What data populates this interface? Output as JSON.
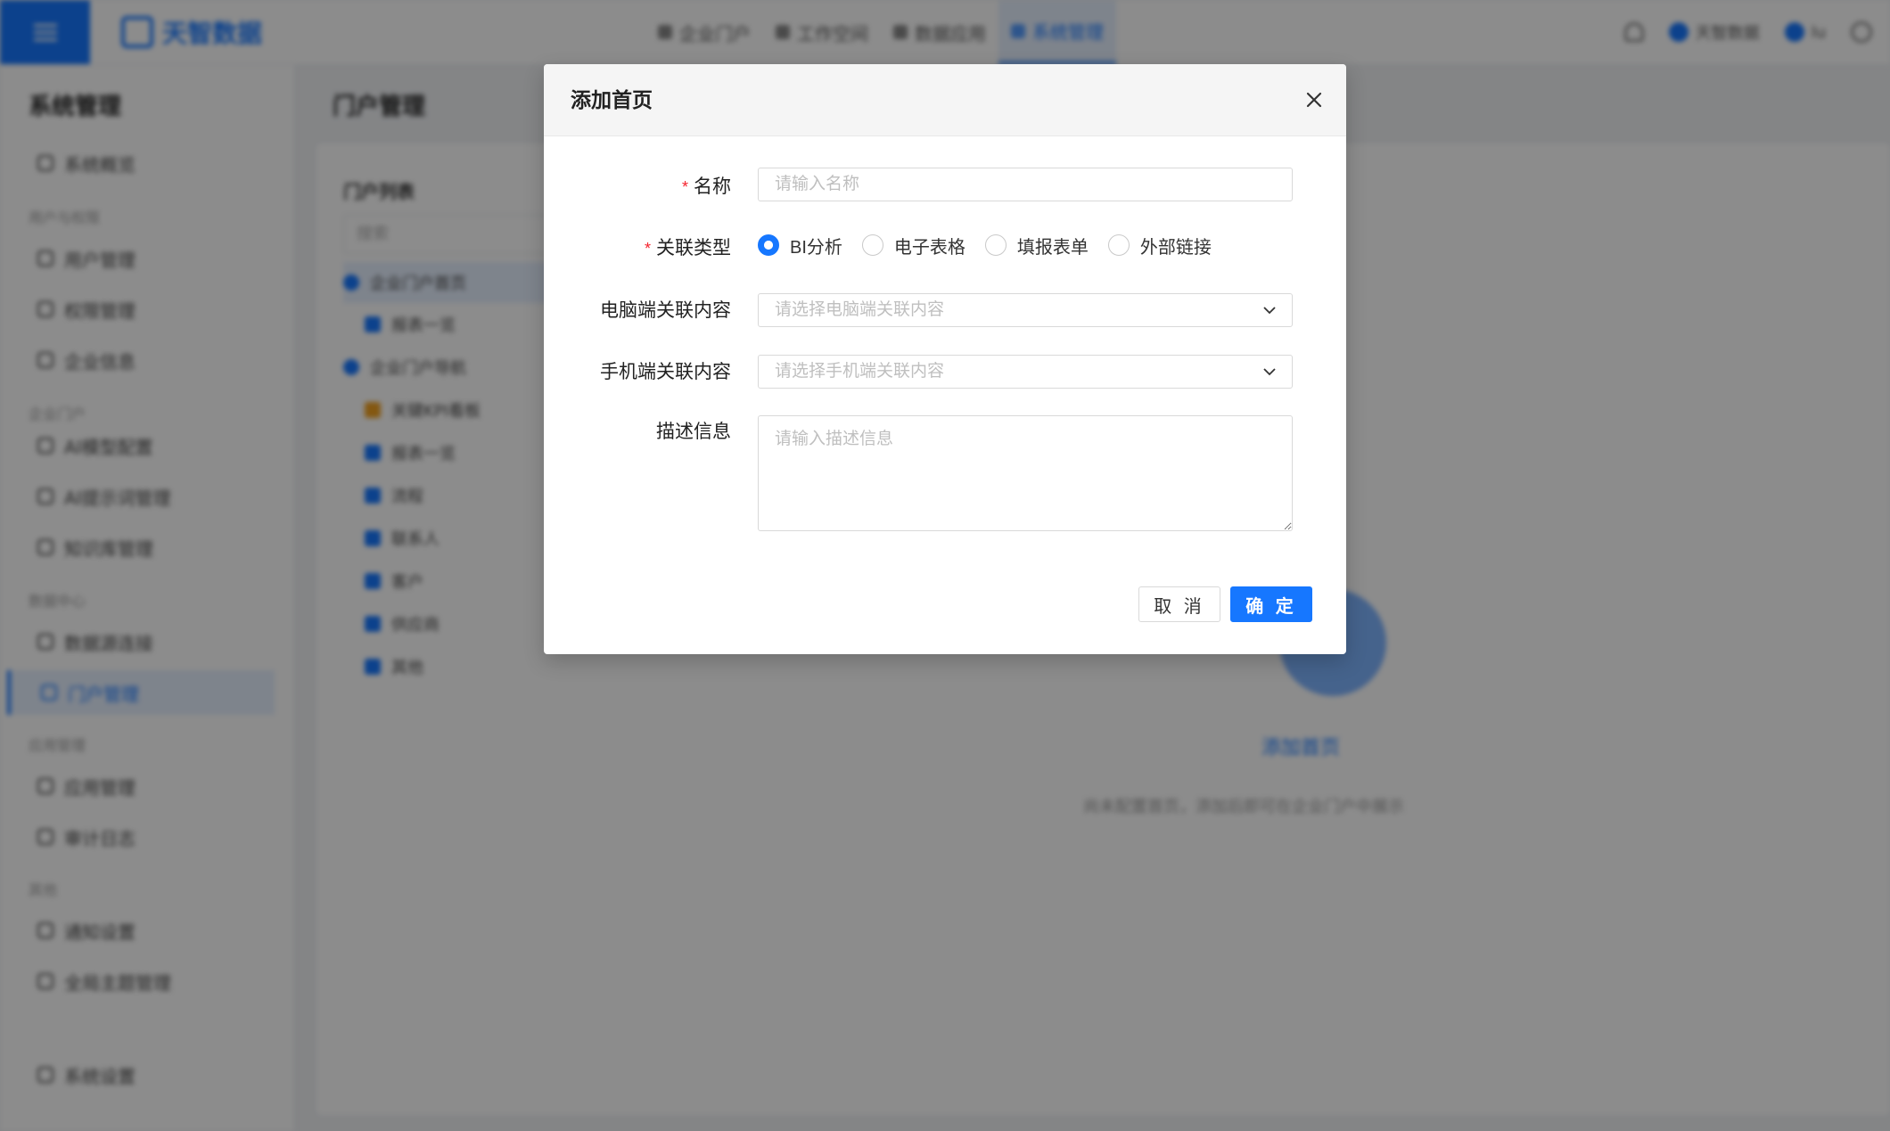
{
  "app": {
    "brand": "天智数据",
    "topnav": [
      {
        "label": "企业门户",
        "active": false
      },
      {
        "label": "工作空间",
        "active": false
      },
      {
        "label": "数据应用",
        "active": false
      },
      {
        "label": "系统管理",
        "active": true
      }
    ],
    "user_menu": {
      "org": "天智数据",
      "user": "lu"
    }
  },
  "sidebar": {
    "title": "系统管理",
    "groups": [
      {
        "label": "用户与权限"
      },
      {
        "label": "企业门户"
      },
      {
        "label": "数据中心"
      },
      {
        "label": "应用管理"
      },
      {
        "label": "其他"
      }
    ],
    "items": [
      {
        "label": "系统概览"
      },
      {
        "label": "用户管理"
      },
      {
        "label": "权限管理"
      },
      {
        "label": "企业信息"
      },
      {
        "label": "AI模型配置"
      },
      {
        "label": "AI提示词管理"
      },
      {
        "label": "知识库管理"
      },
      {
        "label": "数据源连接"
      },
      {
        "label": "门户管理",
        "active": true
      },
      {
        "label": "应用管理"
      },
      {
        "label": "审计日志"
      },
      {
        "label": "通知设置"
      },
      {
        "label": "全局主题管理"
      },
      {
        "label": "系统设置"
      }
    ]
  },
  "main": {
    "page_title": "门户管理",
    "tree_title": "门户列表",
    "tree_search_placeholder": "搜索",
    "tree_items": [
      {
        "label": "企业门户首页"
      },
      {
        "label": "报表一览"
      },
      {
        "label": "企业门户导航"
      },
      {
        "label": "关键KPI看板"
      },
      {
        "label": "报表一览"
      },
      {
        "label": "流程"
      },
      {
        "label": "联系人"
      },
      {
        "label": "客户"
      },
      {
        "label": "供应商"
      },
      {
        "label": "其他"
      }
    ],
    "empty_link": "添加首页",
    "empty_desc": "尚未配置首页，添加后即可在企业门户中展示"
  },
  "modal": {
    "title": "添加首页",
    "close_icon": "close-icon",
    "fields": {
      "name": {
        "label": "名称",
        "placeholder": "请输入名称",
        "value": "",
        "required": true
      },
      "type": {
        "label": "关联类型",
        "required": true,
        "options": [
          "BI分析",
          "电子表格",
          "填报表单",
          "外部链接"
        ],
        "selected": "BI分析"
      },
      "pc_content": {
        "label": "电脑端关联内容",
        "placeholder": "请选择电脑端关联内容"
      },
      "mobile_content": {
        "label": "手机端关联内容",
        "placeholder": "请选择手机端关联内容"
      },
      "description": {
        "label": "描述信息",
        "placeholder": "请输入描述信息",
        "value": ""
      }
    },
    "buttons": {
      "cancel": "取 消",
      "ok": "确 定"
    },
    "accent_color": "#1677ff",
    "required_color": "#f5222d"
  }
}
